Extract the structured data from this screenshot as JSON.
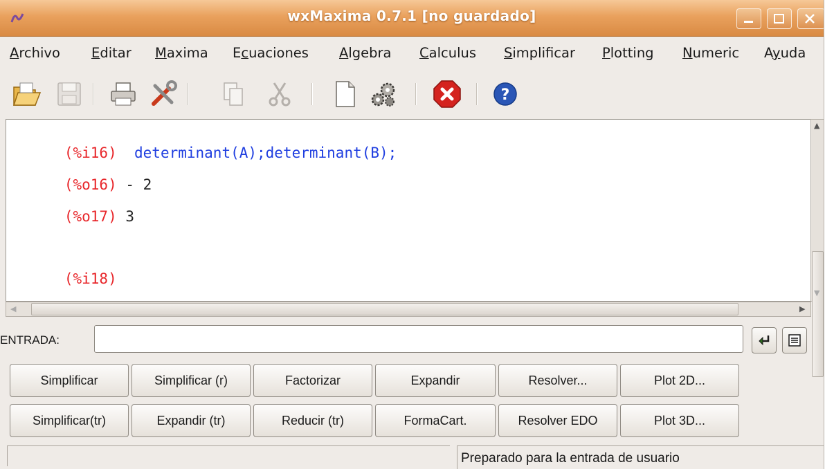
{
  "window": {
    "title": "wxMaxima 0.7.1 [no guardado]"
  },
  "menu": [
    {
      "label": "Archivo",
      "mnemonic": "A",
      "rest": "rchivo"
    },
    {
      "label": "Editar",
      "mnemonic": "E",
      "rest": "ditar"
    },
    {
      "label": "Maxima",
      "mnemonic": "M",
      "rest": "axima"
    },
    {
      "label": "Ecuaciones",
      "pre": "E",
      "mnemonic": "c",
      "rest": "uaciones"
    },
    {
      "label": "Algebra",
      "mnemonic": "A",
      "rest": "lgebra"
    },
    {
      "label": "Calculus",
      "mnemonic": "C",
      "rest": "alculus"
    },
    {
      "label": "Simplificar",
      "mnemonic": "S",
      "rest": "implificar"
    },
    {
      "label": "Plotting",
      "mnemonic": "P",
      "rest": "lotting"
    },
    {
      "label": "Numeric",
      "mnemonic": "N",
      "rest": "umeric"
    },
    {
      "label": "Ayuda",
      "pre": "A",
      "mnemonic": "y",
      "rest": "uda"
    }
  ],
  "toolbar": {
    "icons": [
      "open-icon",
      "save-icon",
      "print-icon",
      "preferences-icon",
      "copy-icon",
      "cut-icon",
      "new-icon",
      "configure-icon",
      "interrupt-icon",
      "help-icon"
    ]
  },
  "worksheet": {
    "lines": [
      {
        "label": "(%i16)",
        "text": "determinant(A);determinant(B);",
        "kind": "input"
      },
      {
        "label": "(%o16)",
        "text": "- 2",
        "kind": "output"
      },
      {
        "label": "(%o17)",
        "text": "3",
        "kind": "output"
      },
      {
        "label": "(%i18)",
        "text": "",
        "kind": "input"
      }
    ]
  },
  "entrada": {
    "label": "ENTRADA:",
    "value": ""
  },
  "buttons": {
    "row1": [
      "Simplificar",
      "Simplificar (r)",
      "Factorizar",
      "Expandir",
      "Resolver...",
      "Plot 2D..."
    ],
    "row2": [
      "Simplificar(tr)",
      "Expandir (tr)",
      "Reducir (tr)",
      "FormaCart.",
      "Resolver EDO",
      "Plot 3D..."
    ]
  },
  "status": {
    "left": "",
    "right": "Preparado para la entrada de usuario"
  },
  "colors": {
    "titlebar": "#e9a15d",
    "input_label": "#e8262a",
    "input_text": "#1f3ee0",
    "output_text": "#222222"
  }
}
